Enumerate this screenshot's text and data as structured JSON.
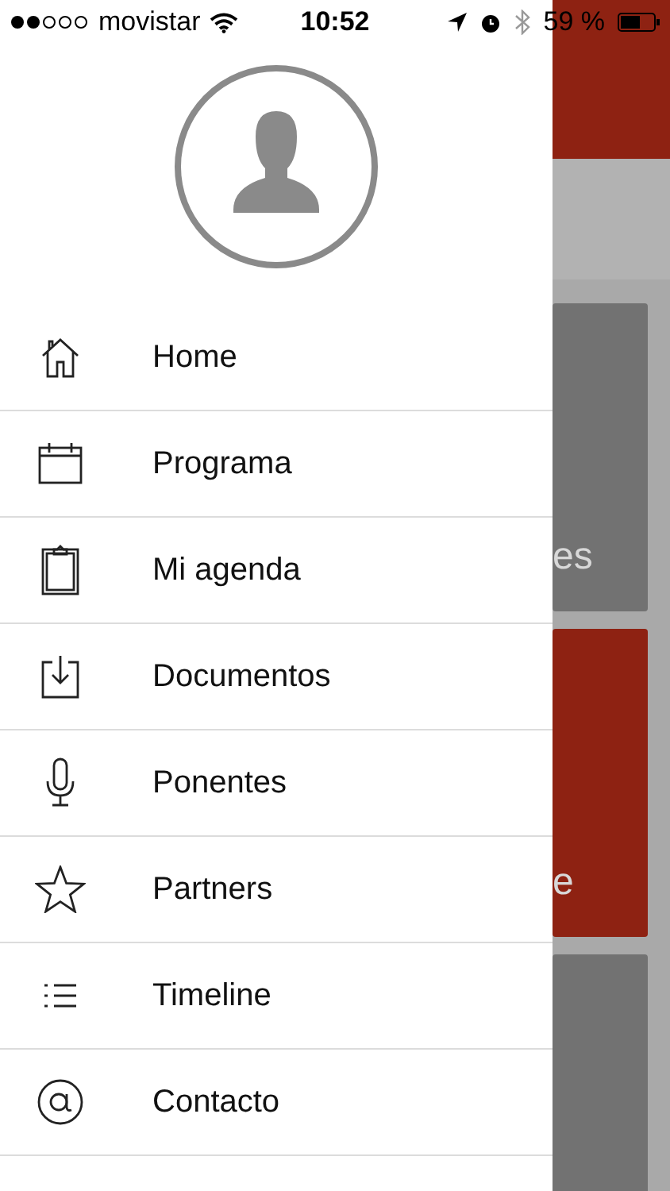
{
  "status_bar": {
    "carrier": "movistar",
    "time": "10:52",
    "battery": "59 %"
  },
  "menu": [
    {
      "label": "Home"
    },
    {
      "label": "Programa"
    },
    {
      "label": "Mi agenda"
    },
    {
      "label": "Documentos"
    },
    {
      "label": "Ponentes"
    },
    {
      "label": "Partners"
    },
    {
      "label": "Timeline"
    },
    {
      "label": "Contacto"
    }
  ],
  "background": {
    "cards": [
      {
        "text": "es",
        "color": "#727272"
      },
      {
        "text": "e",
        "color": "#8e2212"
      },
      {
        "color": "#727272"
      }
    ]
  }
}
